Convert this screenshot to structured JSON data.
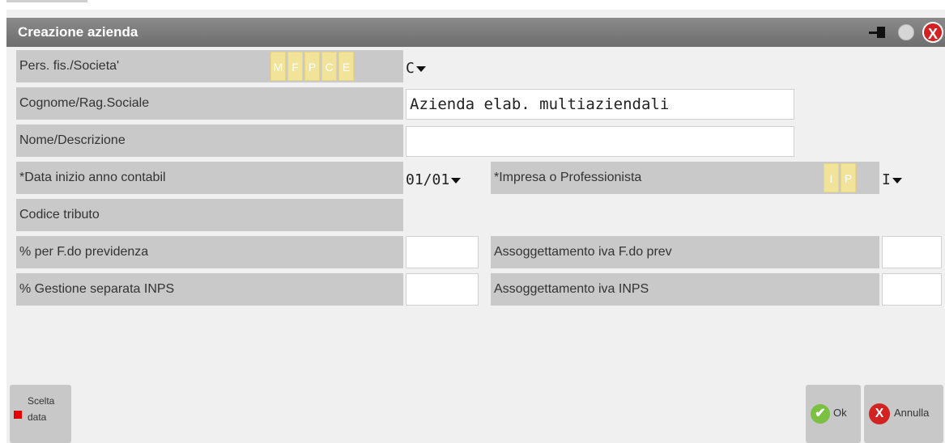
{
  "window": {
    "title": "Creazione azienda",
    "close_glyph": "X",
    "icons": [
      "pin-icon",
      "circle-icon",
      "close-icon"
    ]
  },
  "form": {
    "pers_fis_label": "Pers. fis./Societa'",
    "pers_fis_options": [
      "M",
      "F",
      "P",
      "C",
      "E"
    ],
    "pers_fis_value": "C",
    "cognome_label": "Cognome/Rag.Sociale",
    "cognome_value": "Azienda elab. multiaziendali",
    "nome_label": "Nome/Descrizione",
    "nome_value": "",
    "data_label": "*Data inizio anno contabil",
    "data_value": "01/01",
    "impresa_label": "*Impresa o Professionista",
    "impresa_options": [
      "I",
      "P"
    ],
    "impresa_value": "I",
    "codice_label": "Codice tributo",
    "fdo_prev_label": "% per F.do previdenza",
    "fdo_prev_value": "",
    "assog_fdo_label": "Assoggettamento iva F.do prev",
    "assog_fdo_value": "",
    "gest_sep_label": "% Gestione separata INPS",
    "gest_sep_value": "",
    "assog_inps_label": "Assoggettamento iva INPS",
    "assog_inps_value": ""
  },
  "footer": {
    "scelta_line1": "Scelta",
    "scelta_line2": "data",
    "ok_label": "Ok",
    "annulla_label": "Annulla",
    "ok_glyph": "✔",
    "x_glyph": "X"
  },
  "colors": {
    "titlebar": "#7a7a7a",
    "label_bg": "#c9c9c9",
    "option_bg": "#f2e39a",
    "ok_green": "#7bc043",
    "cancel_red": "#d32222",
    "marker_red": "#e20000"
  }
}
